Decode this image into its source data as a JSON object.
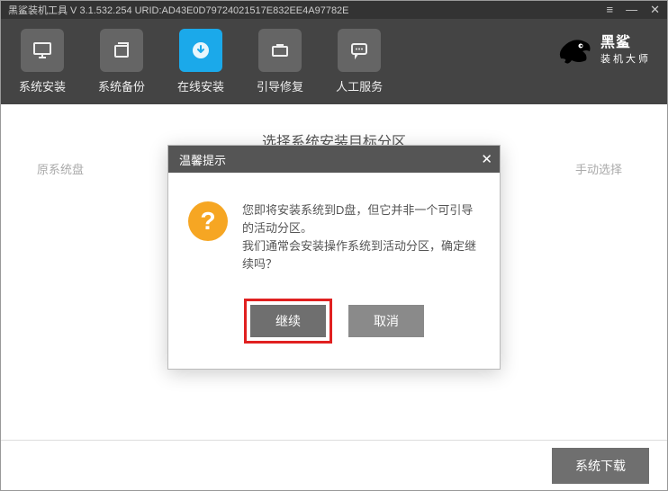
{
  "titlebar": {
    "text": "黑鲨装机工具 V 3.1.532.254 URID:AD43E0D79724021517E832EE4A97782E"
  },
  "toolbar": {
    "items": [
      {
        "label": "系统安装"
      },
      {
        "label": "系统备份"
      },
      {
        "label": "在线安装"
      },
      {
        "label": "引导修复"
      },
      {
        "label": "人工服务"
      }
    ]
  },
  "brand": {
    "line1": "黑鲨",
    "line2": "装机大师"
  },
  "content": {
    "section_title": "选择系统安装目标分区",
    "hint_left": "原系统盘",
    "hint_right": "手动选择"
  },
  "modal": {
    "title": "温馨提示",
    "message_line1": "您即将安装系统到D盘，但它并非一个可引导的活动分区。",
    "message_line2": "我们通常会安装操作系统到活动分区，确定继续吗？",
    "btn_continue": "继续",
    "btn_cancel": "取消"
  },
  "footer": {
    "download_btn": "系统下载"
  }
}
